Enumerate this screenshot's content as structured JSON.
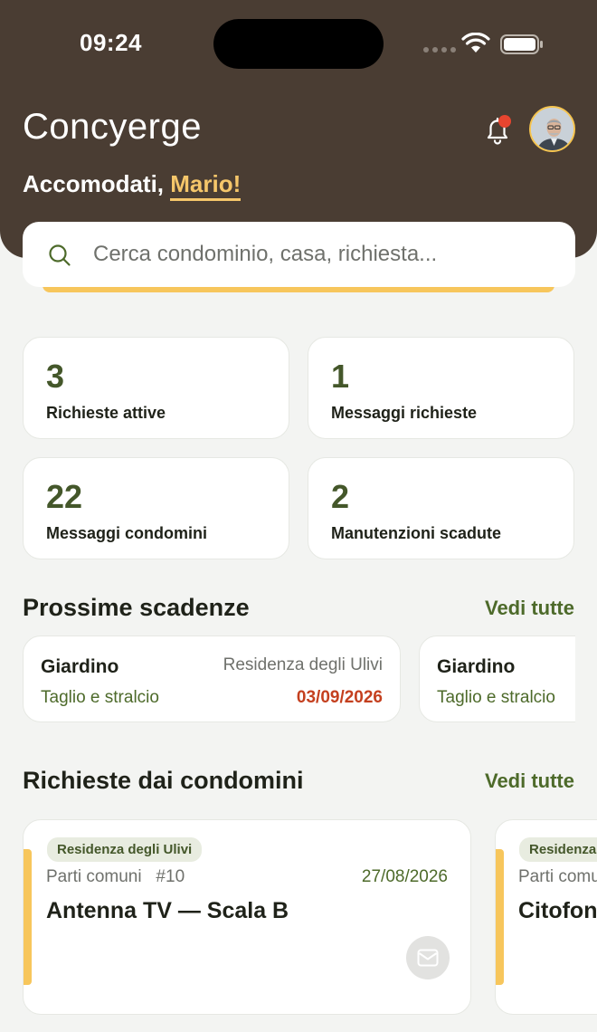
{
  "status_bar": {
    "time": "09:24"
  },
  "header": {
    "app_title": "Concyerge",
    "greeting_prefix": "Accomodati, ",
    "greeting_name": "Mario!",
    "bell_icon": "bell-icon",
    "avatar": "user-avatar"
  },
  "search": {
    "placeholder": "Cerca condominio, casa, richiesta..."
  },
  "stats": [
    {
      "value": "3",
      "label": "Richieste attive"
    },
    {
      "value": "1",
      "label": "Messaggi richieste"
    },
    {
      "value": "22",
      "label": "Messaggi condomini"
    },
    {
      "value": "2",
      "label": "Manutenzioni scadute"
    }
  ],
  "deadlines": {
    "title": "Prossime scadenze",
    "see_all": "Vedi tutte",
    "items": [
      {
        "category": "Giardino",
        "place": "Residenza degli Ulivi",
        "task": "Taglio e stralcio",
        "date": "03/09/2026"
      },
      {
        "category": "Giardino",
        "place": "",
        "task": "Taglio e stralcio",
        "date": ""
      }
    ]
  },
  "requests": {
    "title": "Richieste dai condomini",
    "see_all": "Vedi tutte",
    "items": [
      {
        "badge": "Residenza degli Ulivi",
        "meta": "Parti comuni   #10",
        "date": "27/08/2026",
        "title": "Antenna TV — Scala B"
      },
      {
        "badge": "Residenza degli Ulivi",
        "meta": "Parti comuni",
        "date": "",
        "title": "Citofono"
      }
    ]
  },
  "colors": {
    "header_bg": "#4a3d33",
    "accent_yellow": "#f7c65c",
    "accent_green": "#4d6a2a",
    "alert_red": "#c4401f"
  }
}
